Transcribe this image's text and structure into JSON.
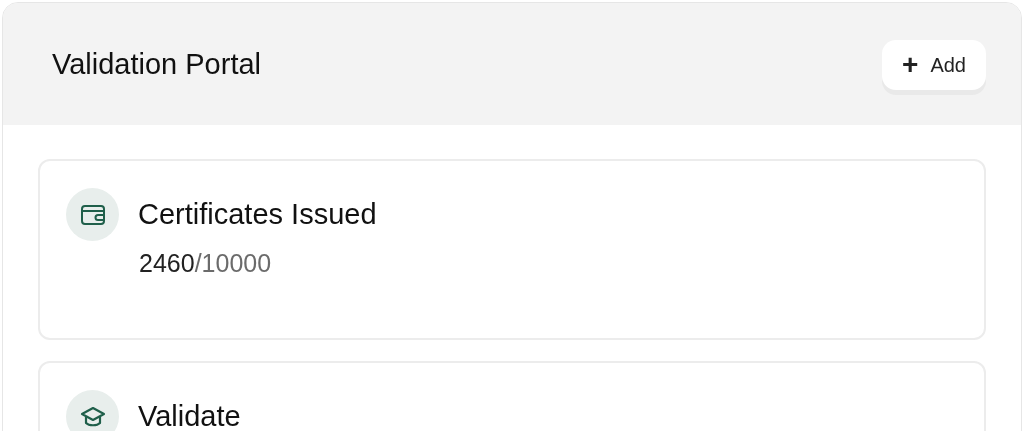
{
  "header": {
    "title": "Validation Portal",
    "add_button": {
      "icon": "+",
      "label": "Add"
    }
  },
  "cards": [
    {
      "kind": "wallet",
      "title": "Certificates Issued",
      "value": "2460",
      "total": "/10000"
    },
    {
      "kind": "cap",
      "title": "Validate"
    }
  ]
}
